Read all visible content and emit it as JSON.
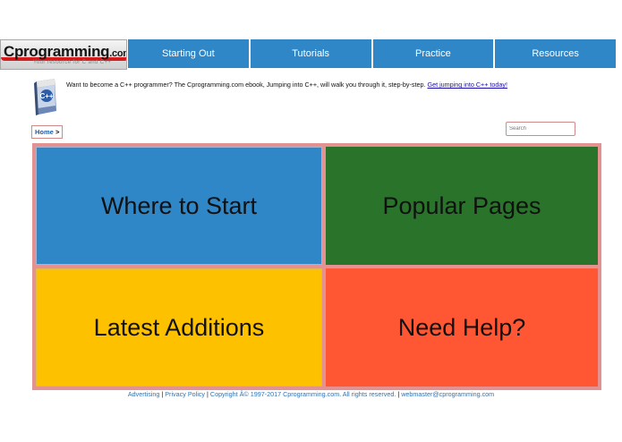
{
  "logo": {
    "main": "Cprogramming",
    "suffix": ".com",
    "tagline": "Your resource for C and C++"
  },
  "nav": {
    "items": [
      {
        "label": "Starting Out"
      },
      {
        "label": "Tutorials"
      },
      {
        "label": "Practice"
      },
      {
        "label": "Resources"
      }
    ]
  },
  "book": {
    "title": "C++",
    "icon": "book-cover-icon"
  },
  "promo": {
    "text": "Want to become a C++ programmer? The Cprogramming.com ebook, Jumping into C++, will walk you through it, step-by-step.",
    "link": "Get jumping into C++ today!"
  },
  "breadcrumb": {
    "home": "Home",
    "separator": ">"
  },
  "search": {
    "placeholder": "Search",
    "value": ""
  },
  "tiles": [
    {
      "label": "Where to Start",
      "color": "#2f87c8"
    },
    {
      "label": "Popular Pages",
      "color": "#29742a"
    },
    {
      "label": "Latest Additions",
      "color": "#fdc100"
    },
    {
      "label": "Need Help?",
      "color": "#ff5733"
    }
  ],
  "footer": {
    "advertising": "Advertising",
    "privacy": "Privacy Policy",
    "copyright": "Copyright Â© 1997-2017 Cprogramming.com. All rights reserved.",
    "email": "webmaster@cprogramming.com",
    "divider": "|"
  }
}
